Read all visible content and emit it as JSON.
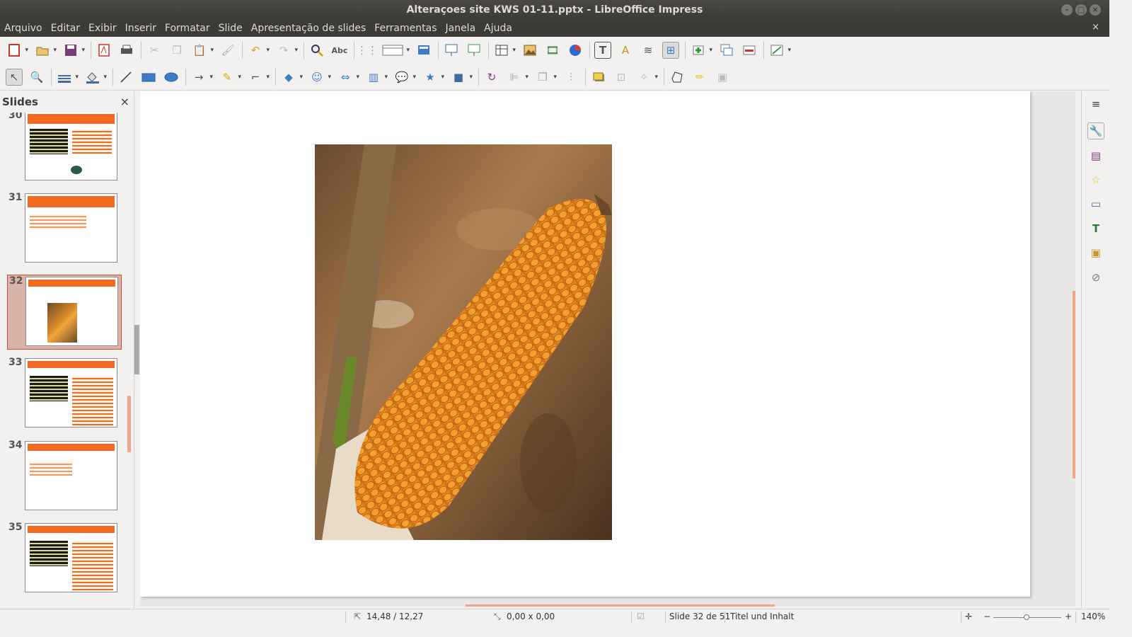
{
  "window": {
    "title": "Alteraçoes site KWS 01-11.pptx - LibreOffice Impress"
  },
  "menu": [
    "Arquivo",
    "Editar",
    "Exibir",
    "Inserir",
    "Formatar",
    "Slide",
    "Apresentação de slides",
    "Ferramentas",
    "Janela",
    "Ajuda"
  ],
  "slides_panel": {
    "title": "Slides",
    "close": "×",
    "slides": [
      {
        "number": "30"
      },
      {
        "number": "31"
      },
      {
        "number": "32",
        "selected": true
      },
      {
        "number": "33"
      },
      {
        "number": "34"
      },
      {
        "number": "35"
      }
    ]
  },
  "status": {
    "position": "14,48 / 12,27",
    "size": "0,00 x 0,00",
    "slide": "Slide 32 de 51",
    "layout": "Titel und Inhalt",
    "zoom": "140%"
  },
  "colors": {
    "accent": "#f26a20",
    "selection": "#d9b3a8"
  }
}
